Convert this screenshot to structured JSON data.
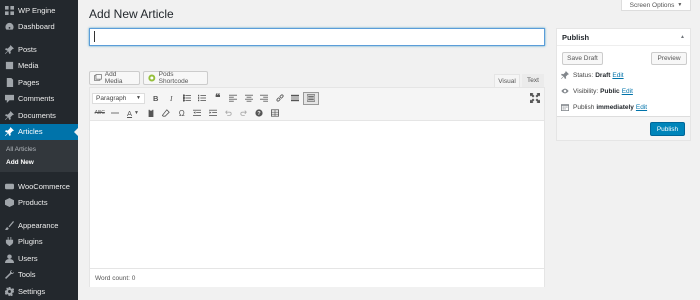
{
  "sidebar": {
    "items": [
      {
        "label": "WP Engine",
        "icon": "wp-engine-icon"
      },
      {
        "label": "Dashboard",
        "icon": "dashboard-icon"
      },
      {
        "label": "Posts",
        "icon": "pin-icon"
      },
      {
        "label": "Media",
        "icon": "media-icon"
      },
      {
        "label": "Pages",
        "icon": "pages-icon"
      },
      {
        "label": "Comments",
        "icon": "comments-icon"
      },
      {
        "label": "Documents",
        "icon": "pin-icon"
      },
      {
        "label": "Articles",
        "icon": "pin-icon",
        "active": true
      },
      {
        "label": "WooCommerce",
        "icon": "woocommerce-icon"
      },
      {
        "label": "Products",
        "icon": "products-icon"
      },
      {
        "label": "Appearance",
        "icon": "appearance-icon"
      },
      {
        "label": "Plugins",
        "icon": "plugins-icon"
      },
      {
        "label": "Users",
        "icon": "users-icon"
      },
      {
        "label": "Tools",
        "icon": "tools-icon"
      },
      {
        "label": "Settings",
        "icon": "settings-icon"
      }
    ],
    "submenu": [
      {
        "label": "All Articles"
      },
      {
        "label": "Add New",
        "current": true
      }
    ]
  },
  "header": {
    "title": "Add New Article",
    "screen_options": "Screen Options"
  },
  "title_field": {
    "value": ""
  },
  "media_buttons": {
    "add_media": "Add Media",
    "pods_shortcode": "Pods Shortcode"
  },
  "editor_tabs": {
    "visual": "Visual",
    "text": "Text"
  },
  "toolbar": {
    "format_select": "Paragraph"
  },
  "editor": {
    "word_count": "Word count: 0"
  },
  "publish": {
    "title": "Publish",
    "save_draft": "Save Draft",
    "preview": "Preview",
    "status_label": "Status:",
    "status_value": "Draft",
    "visibility_label": "Visibility:",
    "visibility_value": "Public",
    "publish_label": "Publish",
    "publish_value": "immediately",
    "edit_link": "Edit",
    "publish_button": "Publish"
  },
  "colors": {
    "sidebar_bg": "#23282d",
    "active_bg": "#0073aa",
    "publish_button": "#0085ba",
    "link": "#0073aa"
  }
}
